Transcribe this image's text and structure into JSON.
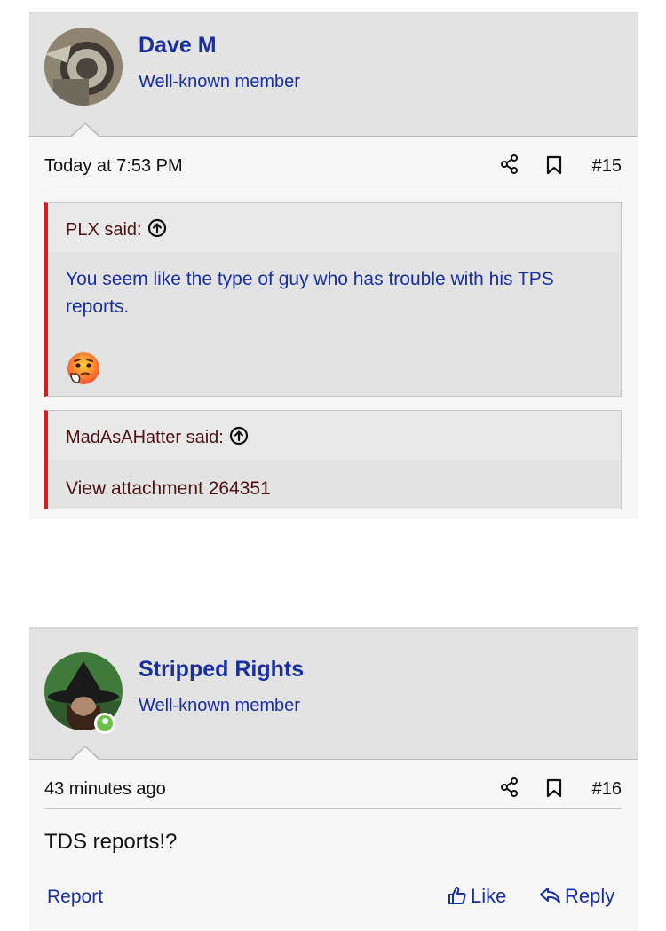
{
  "posts": [
    {
      "username": "Dave M",
      "user_title": "Well-known member",
      "timestamp": "Today at 7:53 PM",
      "post_number": "#15",
      "online": false,
      "quotes": [
        {
          "author": "PLX said:",
          "text": "You seem like the type of guy who has trouble with his TPS reports.",
          "emoji": "thinking-face"
        },
        {
          "author": "MadAsAHatter said:",
          "text": "View attachment 264351"
        }
      ]
    },
    {
      "username": "Stripped Rights",
      "user_title": "Well-known member",
      "timestamp": "43 minutes ago",
      "post_number": "#16",
      "online": true,
      "body": "TDS reports!?",
      "actions": {
        "report": "Report",
        "like": "Like",
        "reply": "Reply"
      }
    }
  ],
  "colors": {
    "link": "#1a2fa0",
    "quote_bar": "#d31f1f",
    "online": "#6cc04a"
  }
}
